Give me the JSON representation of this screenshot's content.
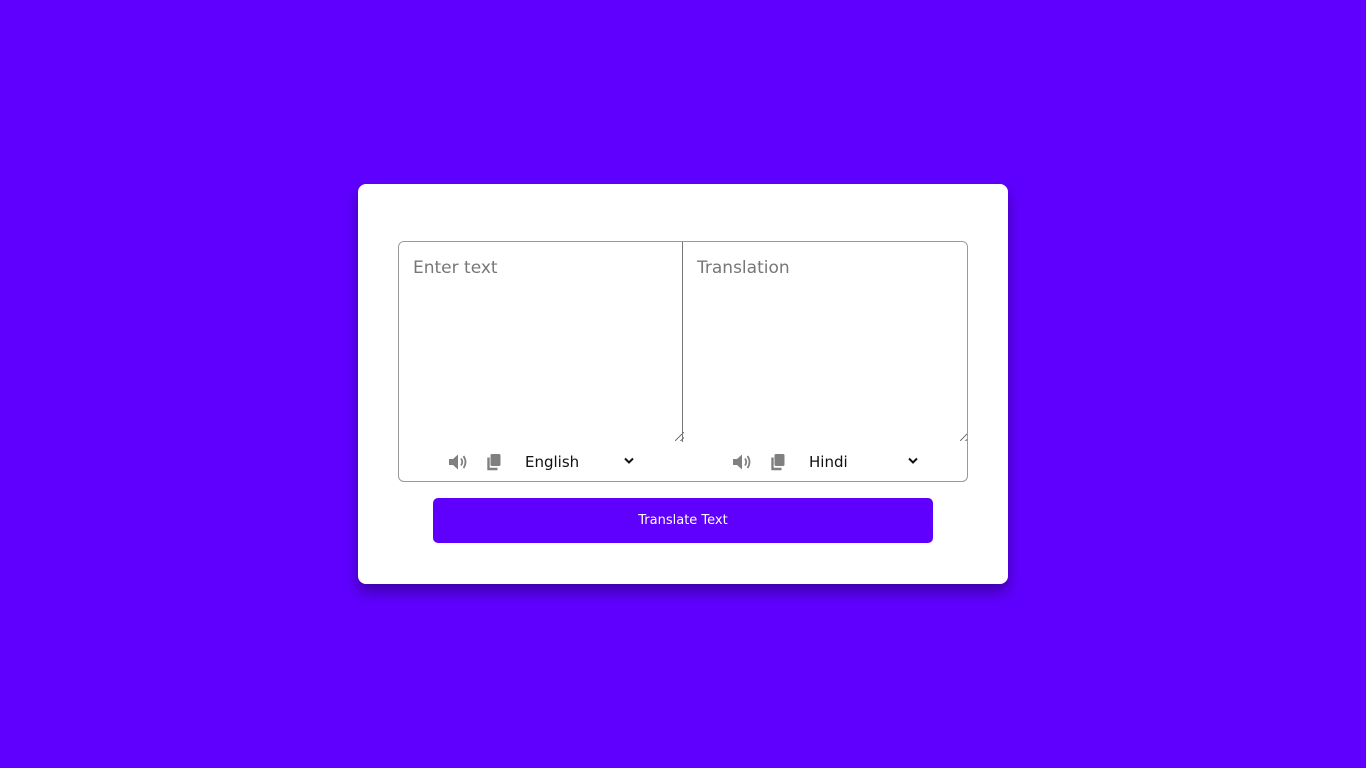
{
  "colors": {
    "background": "#5f00ff",
    "card": "#ffffff",
    "button": "#5f00ff",
    "icon": "#808080"
  },
  "input": {
    "placeholder": "Enter text",
    "value": ""
  },
  "output": {
    "placeholder": "Translation",
    "value": ""
  },
  "from_controls": {
    "speaker_icon": "speaker-volume-icon",
    "copy_icon": "copy-icon",
    "language": "English"
  },
  "to_controls": {
    "speaker_icon": "speaker-volume-icon",
    "copy_icon": "copy-icon",
    "language": "Hindi"
  },
  "translate_button": {
    "label": "Translate Text"
  }
}
